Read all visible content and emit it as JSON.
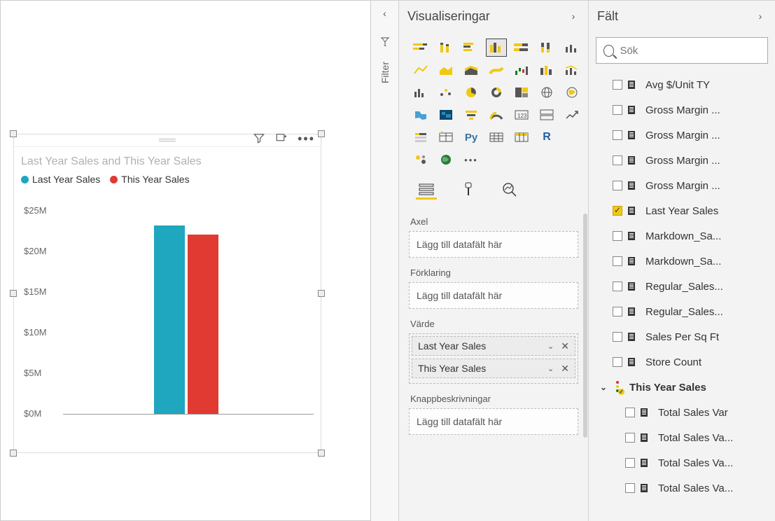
{
  "chart_data": {
    "type": "bar",
    "title": "Last Year Sales and This Year Sales",
    "categories": [
      ""
    ],
    "series": [
      {
        "name": "Last Year Sales",
        "color": "#1ea7bf",
        "values": [
          23200000
        ]
      },
      {
        "name": "This Year Sales",
        "color": "#e03a32",
        "values": [
          22100000
        ]
      }
    ],
    "ylabel": "",
    "yticks": [
      "$0M",
      "$5M",
      "$10M",
      "$15M",
      "$20M",
      "$25M"
    ],
    "ylim": [
      0,
      25000000
    ]
  },
  "legend": {
    "s1": "Last Year Sales",
    "s2": "This Year Sales"
  },
  "filter": {
    "label": "Filter"
  },
  "viz": {
    "title": "Visualiseringar",
    "wells": {
      "axis": {
        "label": "Axel",
        "placeholder": "Lägg till datafält här"
      },
      "legend": {
        "label": "Förklaring",
        "placeholder": "Lägg till datafält här"
      },
      "value": {
        "label": "Värde",
        "items": [
          "Last Year Sales",
          "This Year Sales"
        ]
      },
      "tooltip": {
        "label": "Knappbeskrivningar",
        "placeholder": "Lägg till datafält här"
      }
    }
  },
  "fields": {
    "title": "Fält",
    "search_placeholder": "Sök",
    "items": [
      {
        "label": "Avg $/Unit TY",
        "checked": false,
        "kind": "measure"
      },
      {
        "label": "Gross Margin ...",
        "checked": false,
        "kind": "measure"
      },
      {
        "label": "Gross Margin ...",
        "checked": false,
        "kind": "measure"
      },
      {
        "label": "Gross Margin ...",
        "checked": false,
        "kind": "measure"
      },
      {
        "label": "Gross Margin ...",
        "checked": false,
        "kind": "measure"
      },
      {
        "label": "Last Year Sales",
        "checked": true,
        "kind": "measure"
      },
      {
        "label": "Markdown_Sa...",
        "checked": false,
        "kind": "measure"
      },
      {
        "label": "Markdown_Sa...",
        "checked": false,
        "kind": "measure"
      },
      {
        "label": "Regular_Sales...",
        "checked": false,
        "kind": "measure"
      },
      {
        "label": "Regular_Sales...",
        "checked": false,
        "kind": "measure"
      },
      {
        "label": "Sales Per Sq Ft",
        "checked": false,
        "kind": "measure"
      },
      {
        "label": "Store Count",
        "checked": false,
        "kind": "measure"
      },
      {
        "label": "This Year Sales",
        "checked": false,
        "kind": "hier",
        "bold": true,
        "expand": true
      },
      {
        "label": "Total Sales Var",
        "checked": false,
        "kind": "measure",
        "indent": true
      },
      {
        "label": "Total Sales Va...",
        "checked": false,
        "kind": "measure",
        "indent": true
      },
      {
        "label": "Total Sales Va...",
        "checked": false,
        "kind": "measure",
        "indent": true
      },
      {
        "label": "Total Sales Va...",
        "checked": false,
        "kind": "measure",
        "indent": true
      }
    ]
  }
}
